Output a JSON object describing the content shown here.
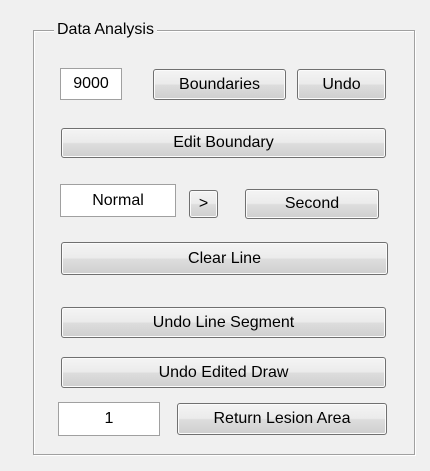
{
  "panel": {
    "title": "Data Analysis"
  },
  "row1": {
    "value_field": "9000",
    "boundaries_label": "Boundaries",
    "undo_label": "Undo"
  },
  "edit_boundary_label": "Edit Boundary",
  "row3": {
    "mode_field": "Normal",
    "next_label": ">",
    "second_label": "Second"
  },
  "clear_line_label": "Clear Line",
  "undo_line_segment_label": "Undo Line Segment",
  "undo_edited_draw_label": "Undo Edited Draw",
  "row_last": {
    "count_field": "1",
    "return_lesion_area_label": "Return Lesion Area"
  }
}
